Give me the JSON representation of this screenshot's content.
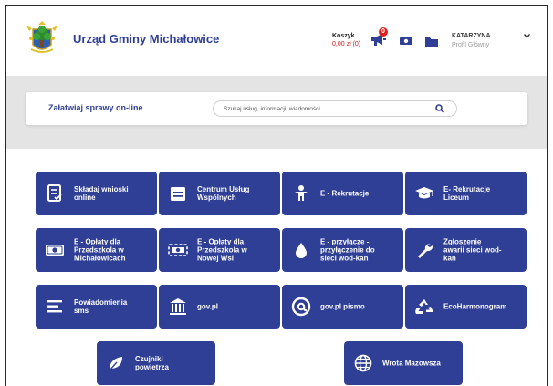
{
  "header": {
    "brand": "Urząd Gminy Michałowice",
    "cart_title": "Koszyk",
    "cart_value": "0,00 zł (0)",
    "notifications_count": "0",
    "user_name": "KATARZYNA",
    "user_profile": "Profil Główny",
    "icons": [
      "coat-of-arms",
      "megaphone-icon",
      "money-icon",
      "folder-icon",
      "chevron-down-icon"
    ]
  },
  "search": {
    "label": "Załatwiaj sprawy on-line",
    "placeholder": "Szukaj usług, informacji, wiadomości"
  },
  "tiles": [
    {
      "label": "Składaj wnioski\nonline",
      "icon": "form-icon"
    },
    {
      "label": "Centrum Usług\nWspólnych",
      "icon": "building-icon"
    },
    {
      "label": "E - Rekrutacje",
      "icon": "child-icon"
    },
    {
      "label": "E- Rekrutacje\nLiceum",
      "icon": "graduation-cap-icon"
    },
    {
      "label": "E - Opłaty dla\nPrzedszkola w\nMichałowicach",
      "icon": "money-icon"
    },
    {
      "label": "E - Opłaty dla\nPrzedszkola w\nNowej Wsi",
      "icon": "money-dashed-icon"
    },
    {
      "label": "E - przyłącze -\nprzyłączenie do\nsieci wod-kan",
      "icon": "water-drop-icon"
    },
    {
      "label": "Zgłoszenie\nawarii sieci wod-\nkan",
      "icon": "wrench-icon"
    },
    {
      "label": "Powiadomienia\nsms",
      "icon": "list-icon"
    },
    {
      "label": "gov.pl",
      "icon": "institution-icon"
    },
    {
      "label": "gov.pl pismo",
      "icon": "at-icon"
    },
    {
      "label": "EcoHarmonogram",
      "icon": "recycle-icon"
    },
    {
      "label": "Czujniki\npowietrza",
      "icon": "leaf-icon"
    },
    {
      "label": "Wrota Mazowsza",
      "icon": "globe-icon"
    }
  ],
  "colors": {
    "brand_blue": "#2f3f95",
    "accent_red": "#e01f1f",
    "background_gray": "#e4e4e4"
  }
}
